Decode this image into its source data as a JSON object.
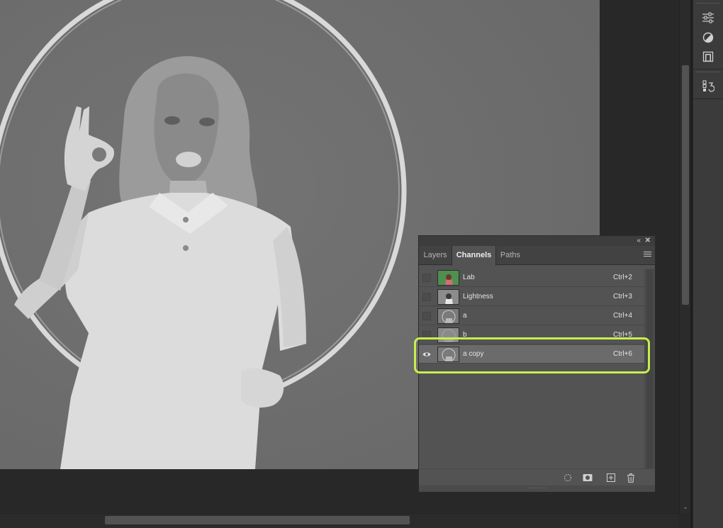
{
  "panel": {
    "tabs": [
      {
        "label": "Layers"
      },
      {
        "label": "Channels"
      },
      {
        "label": "Paths"
      }
    ],
    "active_tab": "Channels",
    "channels": [
      {
        "name": "Lab",
        "shortcut": "Ctrl+2",
        "visible": false,
        "selected": false
      },
      {
        "name": "Lightness",
        "shortcut": "Ctrl+3",
        "visible": false,
        "selected": false
      },
      {
        "name": "a",
        "shortcut": "Ctrl+4",
        "visible": false,
        "selected": false
      },
      {
        "name": "b",
        "shortcut": "Ctrl+5",
        "visible": false,
        "selected": false
      },
      {
        "name": "a copy",
        "shortcut": "Ctrl+6",
        "visible": true,
        "selected": true
      }
    ],
    "footer_buttons": [
      "load-selection-icon",
      "save-selection-icon",
      "new-channel-icon",
      "delete-channel-icon"
    ]
  },
  "dock": {
    "icons": [
      "adjustments-icon",
      "styles-icon",
      "libraries-icon",
      "history-icon"
    ]
  },
  "colors": {
    "highlight": "#c8ee4a",
    "selected_row": "#6b6b6b",
    "panel_bg": "#535353",
    "app_bg": "#282828",
    "document_bg": "#6f6f6f"
  }
}
